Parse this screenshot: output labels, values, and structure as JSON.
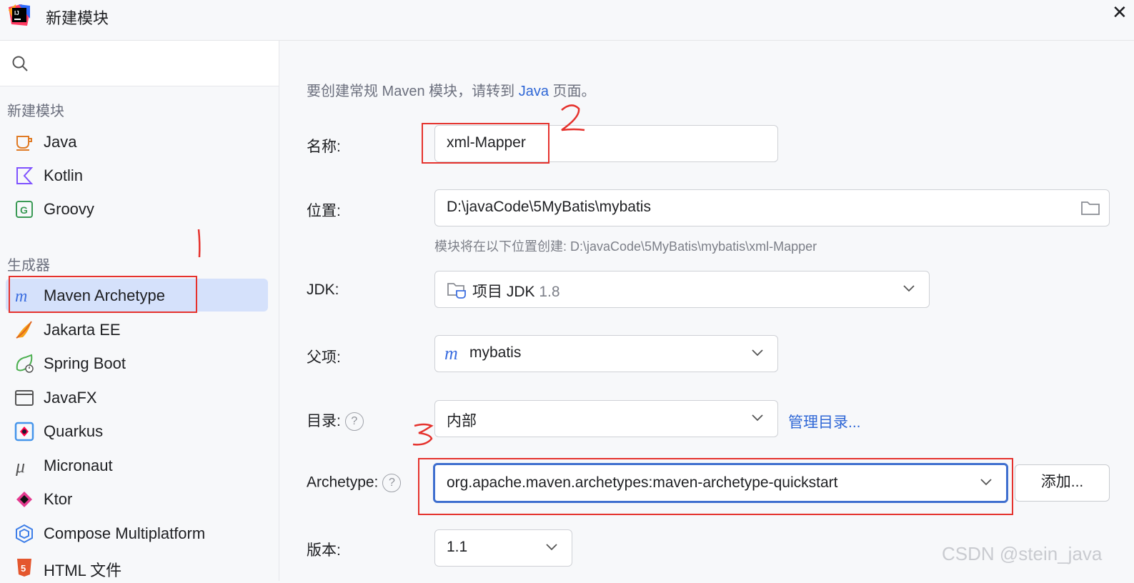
{
  "window": {
    "title": "新建模块"
  },
  "sidebar": {
    "search_icon": "search-icon",
    "group_new": "新建模块",
    "group_generators": "生成器",
    "new_items": [
      {
        "label": "Java",
        "icon": "java-cup-icon"
      },
      {
        "label": "Kotlin",
        "icon": "kotlin-icon"
      },
      {
        "label": "Groovy",
        "icon": "groovy-icon"
      }
    ],
    "generator_items": [
      {
        "label": "Maven Archetype",
        "icon": "maven-icon",
        "selected": true
      },
      {
        "label": "Jakarta EE",
        "icon": "jakarta-icon"
      },
      {
        "label": "Spring Boot",
        "icon": "spring-boot-icon"
      },
      {
        "label": "JavaFX",
        "icon": "javafx-icon"
      },
      {
        "label": "Quarkus",
        "icon": "quarkus-icon"
      },
      {
        "label": "Micronaut",
        "icon": "micronaut-icon"
      },
      {
        "label": "Ktor",
        "icon": "ktor-icon"
      },
      {
        "label": "Compose Multiplatform",
        "icon": "compose-icon"
      },
      {
        "label": "HTML 文件",
        "icon": "html5-icon"
      }
    ]
  },
  "form": {
    "hint_prefix": "要创建常规 Maven 模块，请转到",
    "hint_link": "Java",
    "hint_suffix": "页面。",
    "name_label": "名称:",
    "name_value": "xml-Mapper",
    "location_label": "位置:",
    "location_value": "D:\\javaCode\\5MyBatis\\mybatis",
    "location_note": "模块将在以下位置创建: D:\\javaCode\\5MyBatis\\mybatis\\xml-Mapper",
    "jdk_label": "JDK:",
    "jdk_value": "项目 JDK",
    "jdk_version": "1.8",
    "parent_label": "父项:",
    "parent_value": "mybatis",
    "catalog_label": "目录:",
    "catalog_value": "内部",
    "catalog_manage": "管理目录...",
    "archetype_label": "Archetype:",
    "archetype_value": "org.apache.maven.archetypes:maven-archetype-quickstart",
    "add_button": "添加...",
    "version_label": "版本:",
    "version_value": "1.1",
    "help_glyph": "?"
  },
  "annotations": {
    "mark_1": "1",
    "mark_2": "2",
    "mark_3": "3"
  },
  "watermark": "CSDN @stein_java",
  "colors": {
    "accent": "#2f67d6",
    "selection": "#d5e1fb",
    "annotation_red": "#e5322d"
  }
}
